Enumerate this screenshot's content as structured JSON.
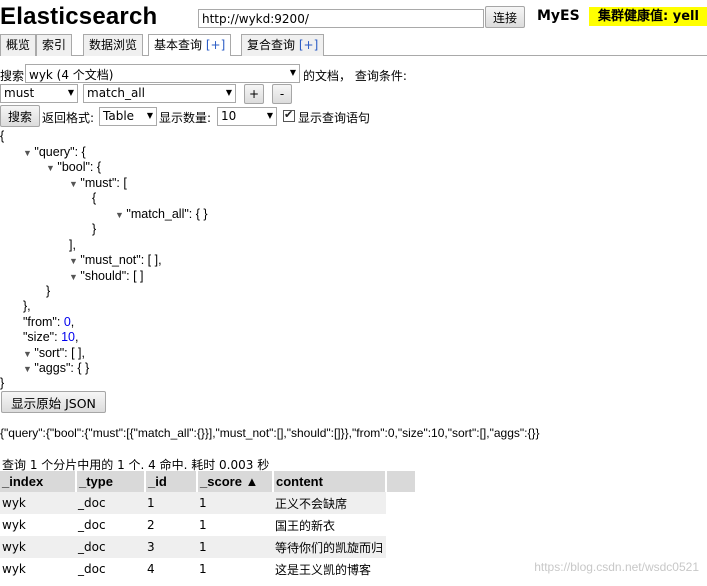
{
  "header": {
    "logo": "Elasticsearch",
    "url_value": "http://wykd:9200/",
    "connect_label": "连接",
    "cluster_name": "MyES",
    "health_text": "集群健康值: yell"
  },
  "tabs": [
    {
      "label": "概览",
      "plus": ""
    },
    {
      "label": "索引",
      "plus": ""
    },
    {
      "label": "数据浏览",
      "plus": ""
    },
    {
      "label": "基本查询 ",
      "plus": "[+]"
    },
    {
      "label": "复合查询 ",
      "plus": "[+]"
    }
  ],
  "query_form": {
    "search_prefix": "搜索",
    "index_select": "wyk (4 个文档)",
    "docs_suffix": "的文档， 查询条件:",
    "bool_select": "must",
    "query_select": "match_all",
    "plus_label": "+",
    "minus_label": "-",
    "search_button": "搜索",
    "return_format_label": "返回格式:",
    "format_select": "Table",
    "size_label": "显示数量:",
    "size_select": "10",
    "show_query_label": "显示查询语句"
  },
  "json_tree": {
    "open": "{",
    "query": "\"query\": {",
    "bool": "\"bool\": {",
    "must": "\"must\": [",
    "must_obj_open": "{",
    "match_all": "\"match_all\": { }",
    "must_obj_close": "}",
    "must_close": "],",
    "must_not": "\"must_not\": [ ],",
    "should": "\"should\": [ ]",
    "bool_close": "}",
    "query_close": "},",
    "from_key": "\"from\": ",
    "from_val": "0",
    "size_key": "\"size\": ",
    "size_val": "10",
    "comma": ",",
    "sort": "\"sort\": [ ],",
    "aggs": "\"aggs\": { }",
    "close": "}"
  },
  "raw_json_button": "显示原始 JSON",
  "raw_json": "{\"query\":{\"bool\":{\"must\":[{\"match_all\":{}}],\"must_not\":[],\"should\":[]}},\"from\":0,\"size\":10,\"sort\":[],\"aggs\":{}}",
  "summary": "查询 1 个分片中用的 1 个. 4 命中. 耗时 0.003 秒",
  "results": {
    "columns": [
      "_index",
      "_type",
      "_id",
      "_score ▲",
      "content"
    ],
    "rows": [
      [
        "wyk",
        "_doc",
        "1",
        "1",
        "正义不会缺席"
      ],
      [
        "wyk",
        "_doc",
        "2",
        "1",
        "国王的新衣"
      ],
      [
        "wyk",
        "_doc",
        "3",
        "1",
        "等待你们的凯旋而归"
      ],
      [
        "wyk",
        "_doc",
        "4",
        "1",
        "这是王义凯的博客"
      ]
    ]
  },
  "watermark": "https://blog.csdn.net/wsdc0521"
}
